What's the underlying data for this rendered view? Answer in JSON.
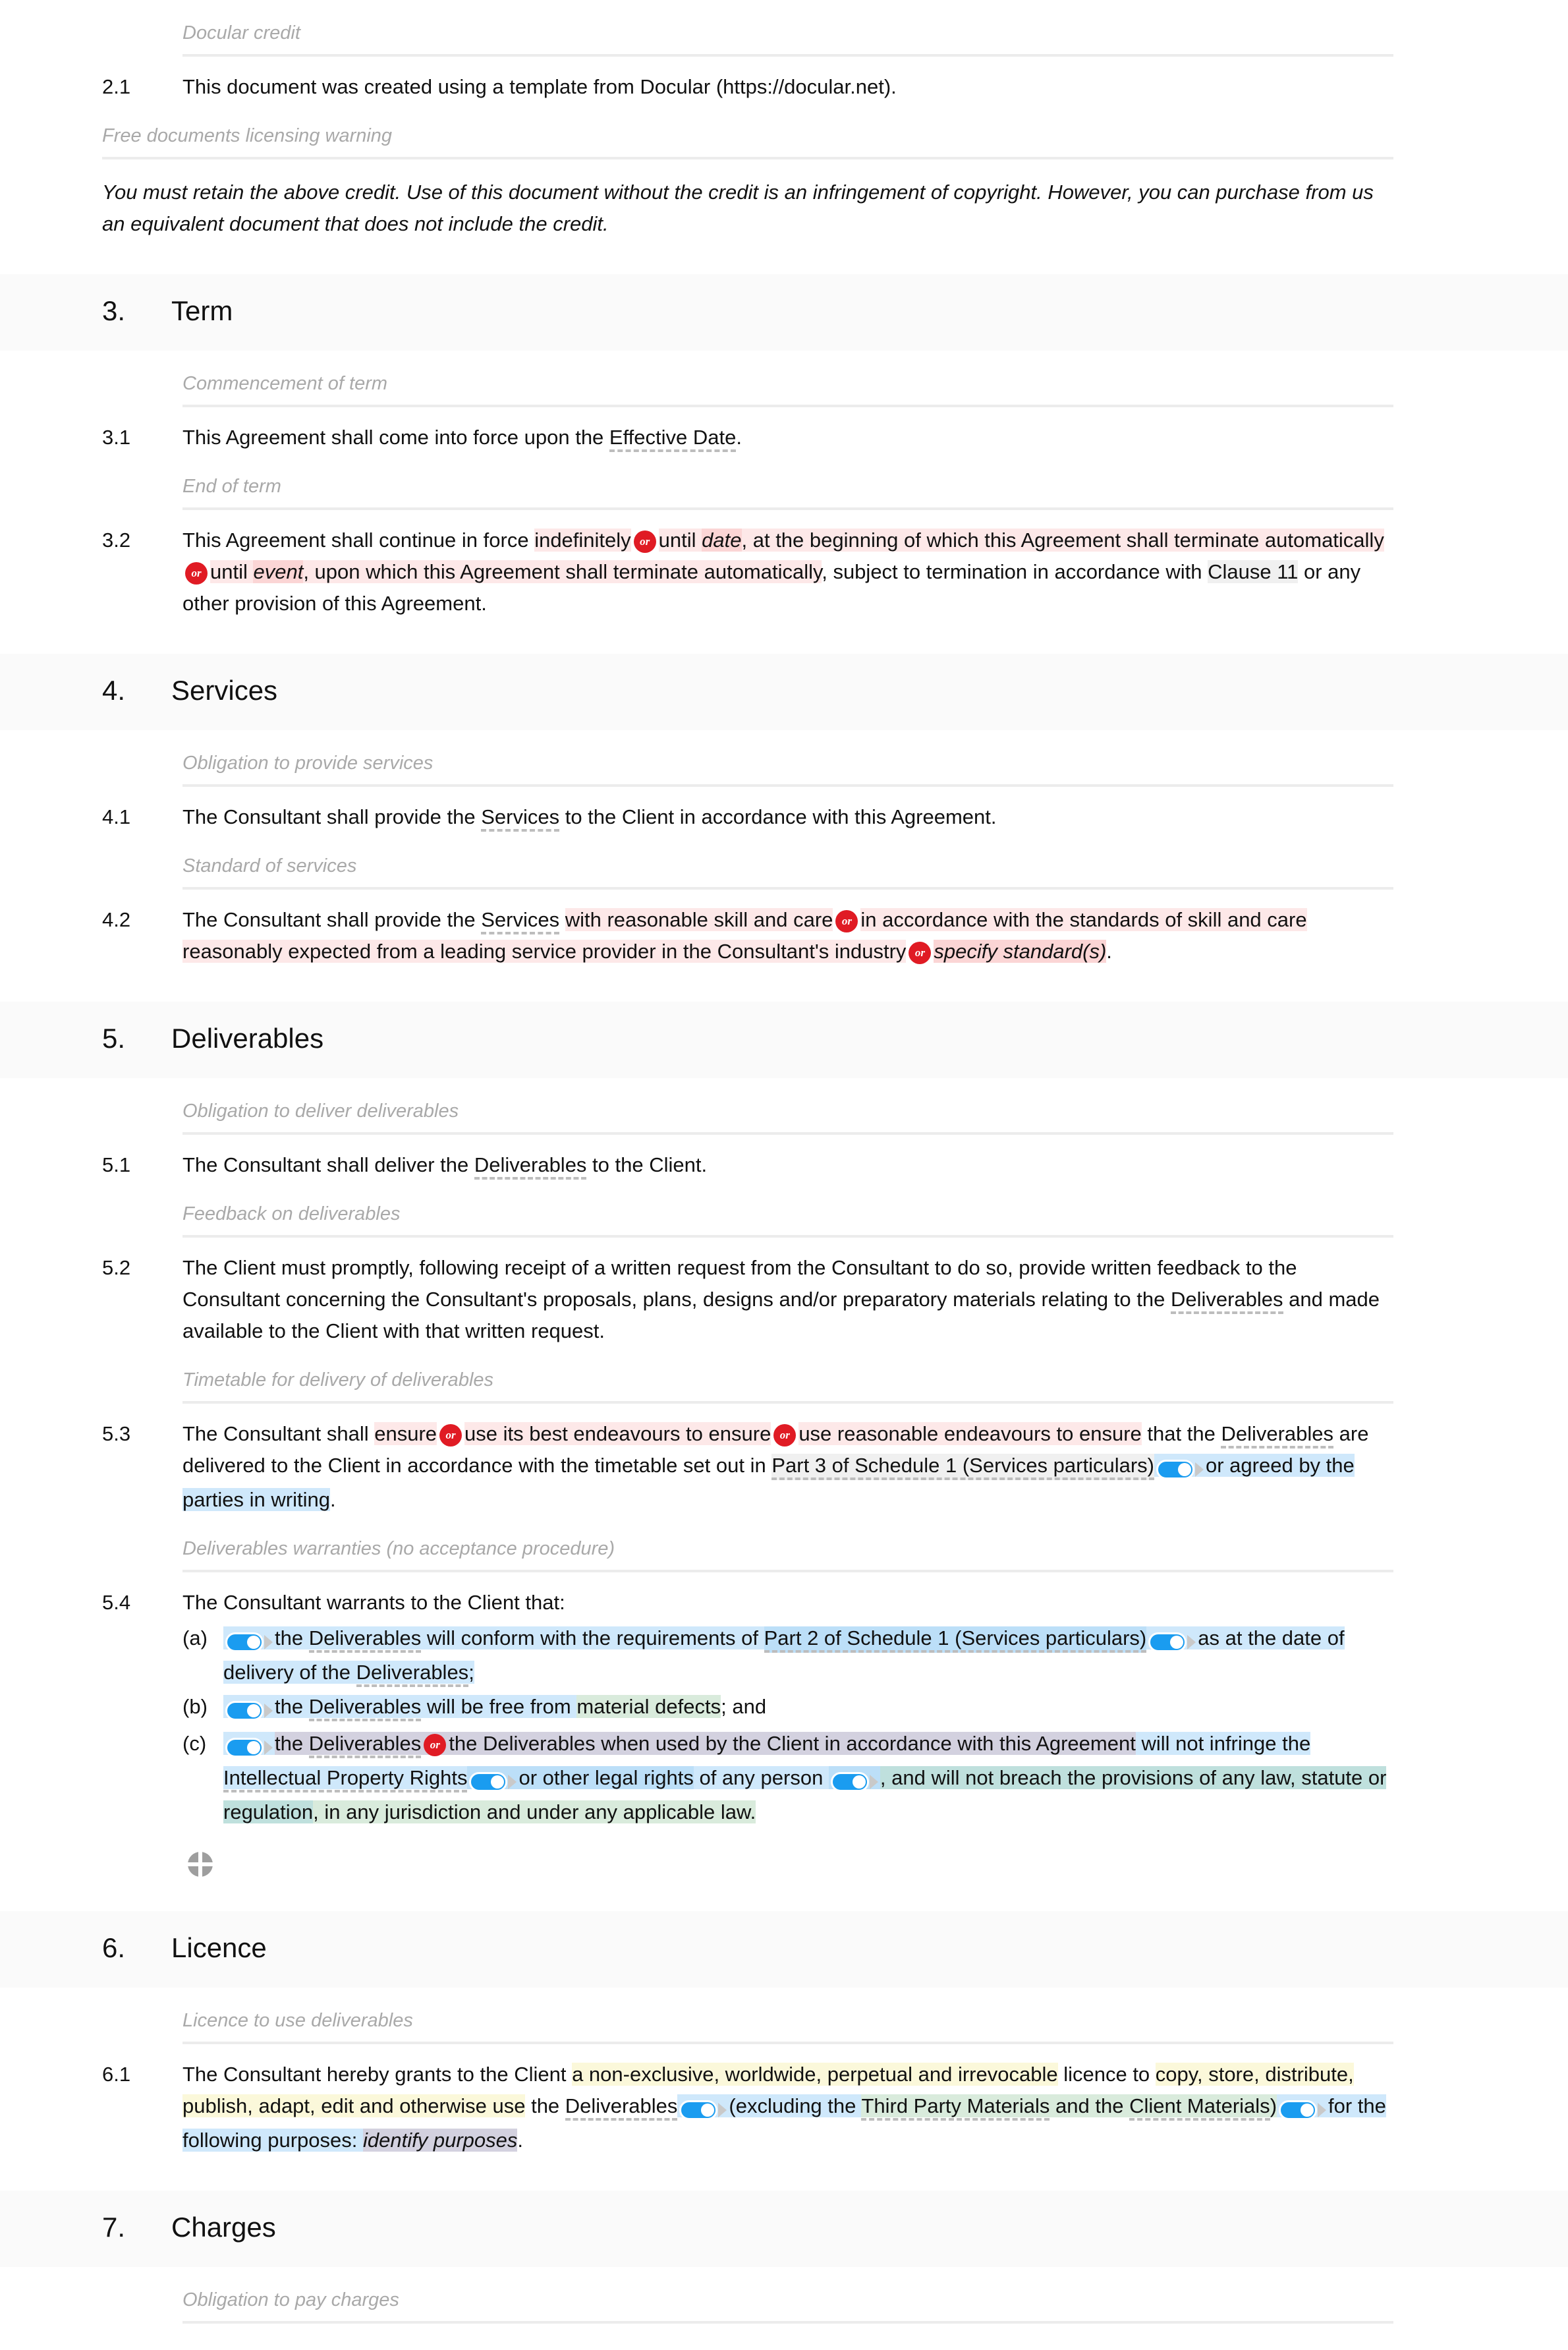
{
  "document": {
    "type": "consultancy-agreement-template",
    "source_name": "Docular"
  },
  "blocks": {
    "docular_credit_label": "Docular credit",
    "clause_2_1_num": "2.1",
    "clause_2_1_text": "This document was created using a template from Docular (https://docular.net).",
    "licensing_warning_label": "Free documents licensing warning",
    "licensing_warning_text": "You must retain the above credit. Use of this document without the credit is an infringement of copyright. However, you can purchase from us an equivalent document that does not include the credit."
  },
  "sections": {
    "term": {
      "number": "3.",
      "title": "Term"
    },
    "services": {
      "number": "4.",
      "title": "Services"
    },
    "deliverables": {
      "number": "5.",
      "title": "Deliverables"
    },
    "licence": {
      "number": "6.",
      "title": "Licence"
    },
    "charges": {
      "number": "7.",
      "title": "Charges"
    }
  },
  "guides": {
    "commencement_of_term": "Commencement of term",
    "end_of_term": "End of term",
    "obligation_to_provide_services": "Obligation to provide services",
    "standard_of_services": "Standard of services",
    "obligation_to_deliver_deliverables": "Obligation to deliver deliverables",
    "feedback_on_deliverables": "Feedback on deliverables",
    "timetable_for_delivery": "Timetable for delivery of deliverables",
    "deliverables_warranties": "Deliverables warranties (no acceptance procedure)",
    "licence_to_use_deliverables": "Licence to use deliverables",
    "obligation_to_pay_charges": "Obligation to pay charges"
  },
  "clause_3_1": {
    "number": "3.1",
    "t1": "This Agreement shall come into force upon the ",
    "term": "Effective Date",
    "t2": "."
  },
  "clause_3_2": {
    "number": "3.2",
    "t1": "This Agreement shall continue in force ",
    "opt1": "indefinitely",
    "or1": "or",
    "opt2_a": "until ",
    "opt2_date": "date",
    "opt2_b": ", at the beginning of which this Agreement shall terminate automatically",
    "or2": "or",
    "opt3_a": "until ",
    "opt3_event": "event",
    "opt3_b": ", upon which this Agreement shall terminate automatically",
    "t2": ", subject to termination in accordance with ",
    "ref": "Clause 11",
    "t3": " or any other provision of this Agreement."
  },
  "clause_4_1": {
    "number": "4.1",
    "t1": "The Consultant shall provide the ",
    "term": "Services",
    "t2": " to the Client in accordance with this Agreement."
  },
  "clause_4_2": {
    "number": "4.2",
    "t1": "The Consultant shall provide the ",
    "term": "Services",
    "t2": " ",
    "opt1": "with reasonable skill and care",
    "or1": "or",
    "opt2": "in accordance with the standards of skill and care reasonably expected from a leading service provider in the Consultant's industry",
    "or2": "or",
    "opt3": "specify standard(s)",
    "t3": "."
  },
  "clause_5_1": {
    "number": "5.1",
    "t1": "The Consultant shall deliver the ",
    "term": "Deliverables",
    "t2": " to the Client."
  },
  "clause_5_2": {
    "number": "5.2",
    "t1": "The Client must promptly, following receipt of a written request from the Consultant to do so, provide written feedback to the Consultant concerning the Consultant's proposals, plans, designs and/or preparatory materials relating to the ",
    "term": "Deliverables",
    "t2": " and made available to the Client with that written request."
  },
  "clause_5_3": {
    "number": "5.3",
    "t1": "The Consultant shall ",
    "opt1": "ensure",
    "or1": "or",
    "opt2": "use its best endeavours to ensure",
    "or2": "or",
    "opt3": "use reasonable endeavours to ensure",
    "t2": " that the ",
    "term1": "Deliverables",
    "t3": " are delivered to the Client in accordance with the timetable set out in ",
    "ref": "Part 3 of Schedule 1 (Services particulars)",
    "toggle1": "toggle-on",
    "opt4": "or agreed by the parties in writing",
    "t4": "."
  },
  "clause_5_4": {
    "number": "5.4",
    "intro": "The Consultant warrants to the Client that:",
    "items": [
      {
        "label": "(a)",
        "toggle1": "toggle-on",
        "t1": "the ",
        "term1": "Deliverables",
        "t2": " will conform with the requirements of ",
        "ref": "Part 2 of Schedule 1 (Services particulars)",
        "toggle2": "toggle-on",
        "t3": "as at the date of delivery of the ",
        "term2": "Deliverables",
        "t4": ";"
      },
      {
        "label": "(b)",
        "toggle1": "toggle-on",
        "t1": "the ",
        "term1": "Deliverables",
        "t2": " will be free from ",
        "green": "material defects",
        "t3": "; and"
      },
      {
        "label": "(c)",
        "toggle1": "toggle-on",
        "t1": "the ",
        "term1": "Deliverables",
        "or1": "or",
        "t2": "the Deliverables when used by the Client in accordance with this Agreement",
        "t3": " will not infringe the ",
        "term2": "Intellectual Property Rights",
        "toggle2": "toggle-on",
        "t4": "or other legal rights",
        "t5": " of any person ",
        "toggle3": "toggle-on",
        "t6": ", and will not breach the provisions of any law, statute or regulation",
        "t7": ", in any jurisdiction and under any applicable law."
      }
    ]
  },
  "clause_6_1": {
    "number": "6.1",
    "t1": "The Consultant hereby grants to the Client ",
    "y1": "a non-exclusive, worldwide, perpetual and irrevocable",
    "t2": " licence to ",
    "y2": "copy, store, distribute, publish, adapt, edit and otherwise use",
    "t3": " the ",
    "term1": "Deliverables",
    "toggle1": "toggle-on",
    "t4": "(excluding the ",
    "term2": "Third Party Materials",
    "t5": " and the ",
    "term3": "Client Materials",
    "t6": ")",
    "toggle2": "toggle-on",
    "t7": "for the following purposes: ",
    "t8": "identify purposes",
    "t9": "."
  },
  "icons": {
    "insert_node": "add-circle-icon",
    "toggle": "toggle-switch-on-icon",
    "or_badge": "or-alternative-badge"
  },
  "colors": {
    "option_red": "#fde8e8",
    "option_red_dark": "#fbd5d5",
    "or_badge": "#e01b24",
    "toggle_blue": "#1a9cf0",
    "highlight_blue": "#cfe8fb",
    "highlight_green": "#d9ebdc",
    "highlight_teal": "#bfe0dd",
    "highlight_purple": "#d3d1df",
    "highlight_yellow": "#fbf8da",
    "section_bg": "#fafafa",
    "guide_text": "#a9a9a9"
  }
}
